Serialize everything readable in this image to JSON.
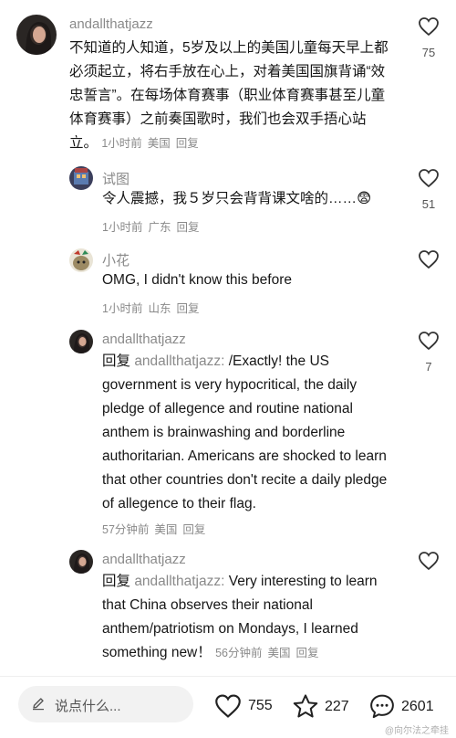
{
  "comments": [
    {
      "username": "andallthatjazz",
      "text": "不知道的人知道，5岁及以上的美国儿童每天早上都必须起立，将右手放在心上，对着美国国旗背诵“效忠誓言”。在每场体育赛事（职业体育赛事甚至儿童体育赛事）之前奏国歌时，我们也会双手捂心站立。",
      "time": "1小时前",
      "location": "美国",
      "reply_label": "回复",
      "likes": "75"
    },
    {
      "username": "试图",
      "text": "令人震撼，我５岁只会背背课文啥的……😨",
      "time": "1小时前",
      "location": "广东",
      "reply_label": "回复",
      "likes": "51"
    },
    {
      "username": "小花",
      "text": "OMG, I didn't know this before",
      "time": "1小时前",
      "location": "山东",
      "reply_label": "回复",
      "likes": ""
    },
    {
      "username": "andallthatjazz",
      "reply_prefix": "回复 ",
      "reply_target": "andallthatjazz:",
      "text": " /Exactly! the US government is very hypocritical, the daily pledge of allegence and routine national anthem is brainwashing and borderline authoritarian. Americans are shocked to learn that other countries don't recite a daily pledge of allegence to their flag.",
      "time": "57分钟前",
      "location": "美国",
      "reply_label": "回复",
      "likes": "7"
    },
    {
      "username": "andallthatjazz",
      "reply_prefix": "回复 ",
      "reply_target": "andallthatjazz:",
      "text": " Very interesting to learn that China observes their national anthem/patriotism on Mondays, I learned something new！",
      "time": "56分钟前",
      "location": "美国",
      "reply_label": "回复",
      "likes": ""
    }
  ],
  "bottom_bar": {
    "input_placeholder": "说点什么...",
    "like_count": "755",
    "favorite_count": "227",
    "comment_count": "2601",
    "watermark": "@向尔法之牵挂"
  },
  "icons": {
    "like": "heart-icon",
    "favorite": "star-icon",
    "comment": "speech-bubble-icon",
    "edit": "pencil-icon"
  }
}
